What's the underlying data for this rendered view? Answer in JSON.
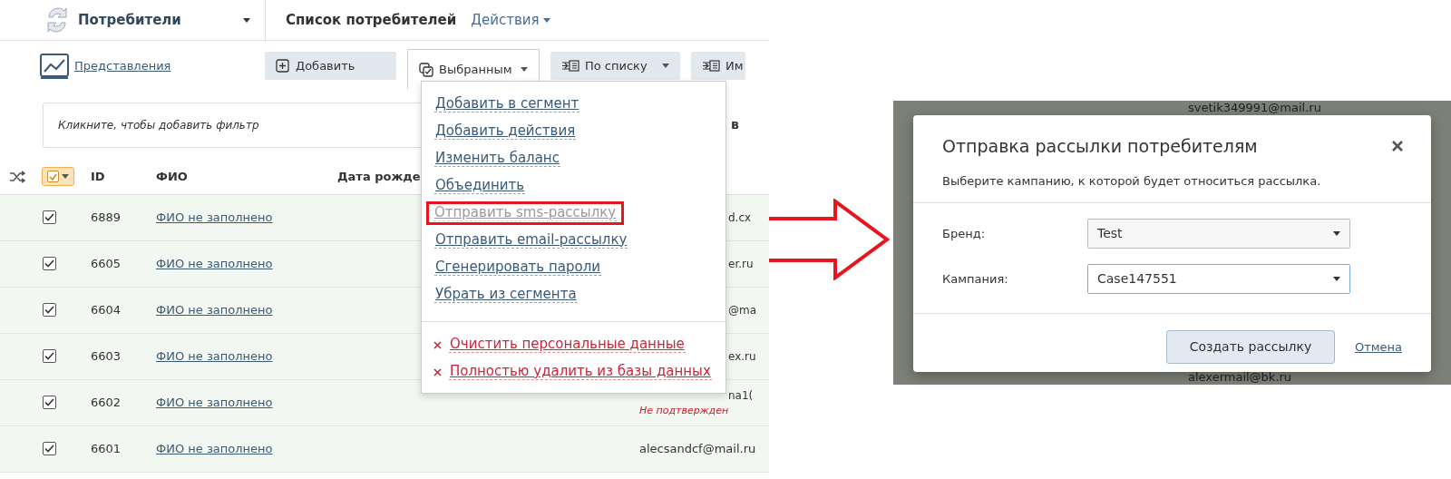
{
  "app_bar": {
    "module": "Потребители",
    "page_title": "Список потребителей",
    "actions_menu": "Действия"
  },
  "toolbar": {
    "views_link": "Представления",
    "buttons": [
      {
        "label": "Добавить",
        "kind": "add",
        "expanded": false
      },
      {
        "label": "Выбранным",
        "kind": "selected",
        "expanded": true
      },
      {
        "label": "По списку",
        "kind": "list",
        "expanded": false
      },
      {
        "label": "Им",
        "kind": "list",
        "expanded": false
      }
    ]
  },
  "filter": {
    "placeholder": "Кликните, чтобы добавить фильтр",
    "trailing_text": "в"
  },
  "table": {
    "select_all": {
      "checked": true
    },
    "columns": [
      "ID",
      "ФИО",
      "Дата рожде"
    ],
    "rows": [
      {
        "checked": true,
        "id": "6889",
        "name": "ФИО не заполнено",
        "email": "d.cx"
      },
      {
        "checked": true,
        "id": "6605",
        "name": "ФИО не заполнено",
        "email": "er.ru"
      },
      {
        "checked": true,
        "id": "6604",
        "name": "ФИО не заполнено",
        "email": "@ma"
      },
      {
        "checked": true,
        "id": "6603",
        "name": "ФИО не заполнено",
        "email": "ex.ru"
      },
      {
        "checked": true,
        "id": "6602",
        "name": "ФИО не заполнено",
        "email": "na1(",
        "email_status": "Не подтвержден"
      },
      {
        "checked": true,
        "id": "6601",
        "name": "ФИО не заполнено",
        "email": "alecsandcf@mail.ru"
      }
    ]
  },
  "menu": [
    {
      "label": "Добавить в сегмент",
      "kind": "action",
      "disabled": false,
      "highlighted": false
    },
    {
      "label": "Добавить действия",
      "kind": "action",
      "disabled": false,
      "highlighted": false
    },
    {
      "label": "Изменить баланс",
      "kind": "action",
      "disabled": false,
      "highlighted": false
    },
    {
      "label": "Объединить",
      "kind": "action",
      "disabled": false,
      "highlighted": false
    },
    {
      "label": "Отправить sms-рассылку",
      "kind": "action",
      "disabled": true,
      "highlighted": true
    },
    {
      "label": "Отправить email-рассылку",
      "kind": "action",
      "disabled": false,
      "highlighted": false
    },
    {
      "label": "Сгенерировать пароли",
      "kind": "action",
      "disabled": false,
      "highlighted": false
    },
    {
      "label": "Убрать из сегмента",
      "kind": "action",
      "disabled": false,
      "highlighted": false
    },
    {
      "label": "Очистить персональные данные",
      "kind": "danger",
      "disabled": false,
      "highlighted": false
    },
    {
      "label": "Полностью удалить из базы данных",
      "kind": "danger",
      "disabled": false,
      "highlighted": false
    }
  ],
  "dialog": {
    "background_emails": [
      "svetik349991@mail.ru",
      "alexermail@bk.ru"
    ],
    "title": "Отправка рассылки потребителям",
    "subtitle": "Выберите кампанию, к которой будет относиться рассылка.",
    "fields": [
      {
        "label": "Бренд:",
        "value": "Test",
        "focused": false
      },
      {
        "label": "Кампания:",
        "value": "Case147551",
        "focused": true
      }
    ],
    "primary_button": "Создать рассылку",
    "cancel_link": "Отмена"
  }
}
